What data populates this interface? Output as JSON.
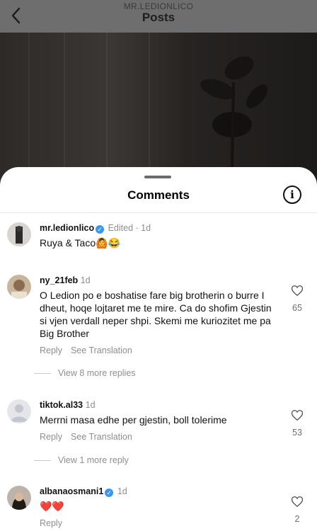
{
  "header": {
    "username": "MR.LEDIONLICO",
    "title": "Posts"
  },
  "sheet": {
    "title": "Comments"
  },
  "comments": [
    {
      "username": "mr.ledionlico",
      "verified": true,
      "meta": "Edited · 1d",
      "text": "Ruya & Taco🙆😂"
    },
    {
      "username": "ny_21feb",
      "meta": "1d",
      "text": "O Ledion po e boshatise fare big brotherin o burre I dheut, hoqe lojtaret me te mire. Ca do shofim Gjestin si vjen verdall neper shpi. Skemi me kuriozitet me pa Big Brother",
      "reply": "Reply",
      "translate": "See Translation",
      "likes": "65",
      "more_replies": "View 8 more replies"
    },
    {
      "username": "tiktok.al33",
      "meta": "1d",
      "text": "Merrni masa edhe per gjestin, boll tolerime",
      "reply": "Reply",
      "translate": "See Translation",
      "likes": "53",
      "more_replies": "View 1 more reply"
    },
    {
      "username": "albanaosmani1",
      "verified": true,
      "meta": "1d",
      "text": "❤️❤️",
      "reply": "Reply",
      "likes": "2"
    }
  ],
  "colors": {
    "verified": "#3897f0",
    "heart": "#ed4956"
  }
}
